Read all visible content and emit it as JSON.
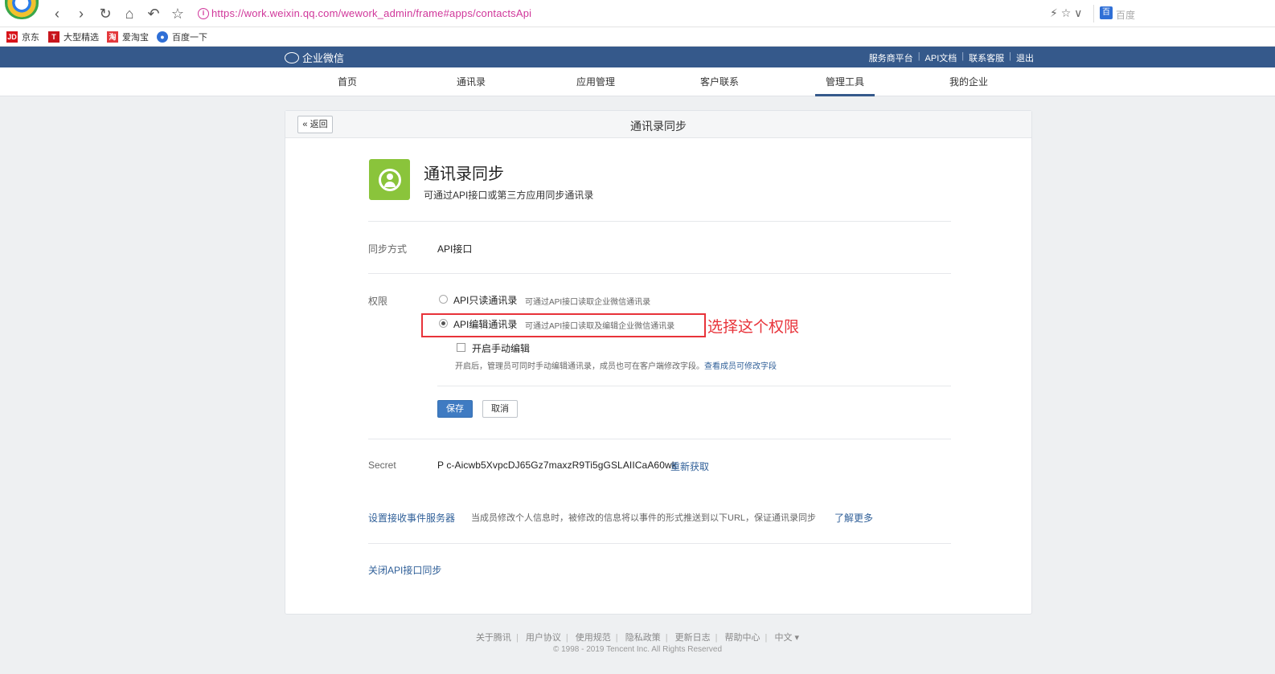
{
  "browser": {
    "url": "https://work.weixin.qq.com/wework_admin/frame#apps/contactsApi",
    "search_engine": "百度",
    "back": "‹",
    "forward": "›",
    "reload": "↻",
    "home": "⌂",
    "undo": "↶",
    "star": "☆",
    "tools": "⚡ ☆ ∨",
    "info": "i"
  },
  "bookmarks": [
    {
      "label": "京东",
      "icon": "JD",
      "color": "#d7141a"
    },
    {
      "label": "大型精选",
      "icon": "T",
      "color": "#c8161d"
    },
    {
      "label": "爱淘宝",
      "icon": "淘",
      "color": "#e4393c"
    },
    {
      "label": "百度一下",
      "icon": "●",
      "color": "#2f6fd6"
    }
  ],
  "header": {
    "brand": "企业微信",
    "links": [
      "服务商平台",
      "API文档",
      "联系客服",
      "退出"
    ]
  },
  "nav": [
    {
      "label": "首页",
      "active": false
    },
    {
      "label": "通讯录",
      "active": false
    },
    {
      "label": "应用管理",
      "active": false
    },
    {
      "label": "客户联系",
      "active": false
    },
    {
      "label": "管理工具",
      "active": true
    },
    {
      "label": "我的企业",
      "active": false
    }
  ],
  "page": {
    "back_label": "« 返回",
    "title": "通讯录同步",
    "app_name": "通讯录同步",
    "app_desc": "可通过API接口或第三方应用同步通讯录",
    "sync_label": "同步方式",
    "sync_value": "API接口",
    "perm_label": "权限",
    "options": [
      {
        "label": "API只读通讯录",
        "desc": "可通过API接口读取企业微信通讯录",
        "checked": false
      },
      {
        "label": "API编辑通讯录",
        "desc": "可通过API接口读取及编辑企业微信通讯录",
        "checked": true
      }
    ],
    "annotation": "选择这个权限",
    "manual_edit_label": "开启手动编辑",
    "manual_hint": "开启后，管理员可同时手动编辑通讯录，成员也可在客户端修改字段。",
    "manual_hint_link": "查看成员可修改字段",
    "save": "保存",
    "cancel": "取消",
    "secret_label": "Secret",
    "secret_value": "P  c-Aicwb5XvpcDJ65Gz7maxzR9Ti5gGSLAIICaA60wk",
    "secret_link": "重新获取",
    "event_link": "设置接收事件服务器",
    "event_desc": "当成员修改个人信息时，被修改的信息将以事件的形式推送到以下URL，保证通讯录同步",
    "event_more": "了解更多",
    "close_link": "关闭API接口同步"
  },
  "footer": {
    "links": [
      "关于腾讯",
      "用户协议",
      "使用规范",
      "隐私政策",
      "更新日志",
      "帮助中心",
      "中文 ▾"
    ],
    "copyright": "© 1998 - 2019 Tencent Inc. All Rights Reserved"
  }
}
